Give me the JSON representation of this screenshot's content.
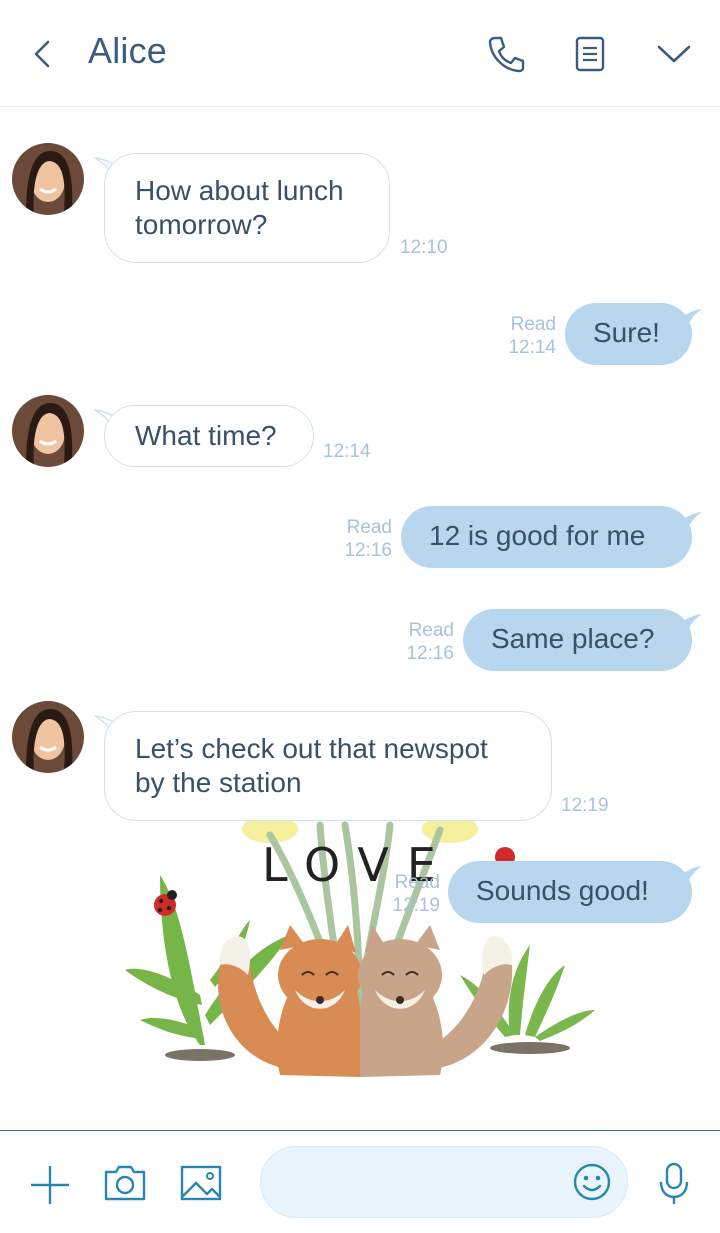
{
  "header": {
    "title": "Alice",
    "icons": [
      "back-chevron-icon",
      "phone-icon",
      "notes-icon",
      "dropdown-chevron-icon"
    ]
  },
  "messages": [
    {
      "side": "in",
      "line1": "How about lunch",
      "line2": "tomorrow?",
      "time": "12:10"
    },
    {
      "side": "out",
      "text": "Sure!",
      "read": "Read",
      "time": "12:14"
    },
    {
      "side": "in",
      "text": "What time?",
      "time": "12:14"
    },
    {
      "side": "out",
      "text": "12 is good for me",
      "read": "Read",
      "time": "12:16"
    },
    {
      "side": "out",
      "text": "Same place?",
      "read": "Read",
      "time": "12:16"
    },
    {
      "side": "in",
      "line1": "Let’s check out that newspot",
      "line2": "by the station",
      "time": "12:19"
    },
    {
      "side": "out",
      "text": "Sounds good!",
      "read": "Read",
      "time": "12:19"
    }
  ],
  "background_art": {
    "word": "LOVE",
    "description_icon": "fox-couple-illustration"
  },
  "footer": {
    "input_placeholder": "",
    "icons": [
      "plus-icon",
      "camera-icon",
      "image-icon",
      "emoji-icon",
      "microphone-icon"
    ]
  },
  "colors": {
    "accent": "#3d5b80",
    "outgoing_bubble": "#b8d6ee",
    "incoming_border": "#cfe2ee",
    "meta_text": "#a9c3da",
    "footer_border": "#2c6f8e"
  }
}
